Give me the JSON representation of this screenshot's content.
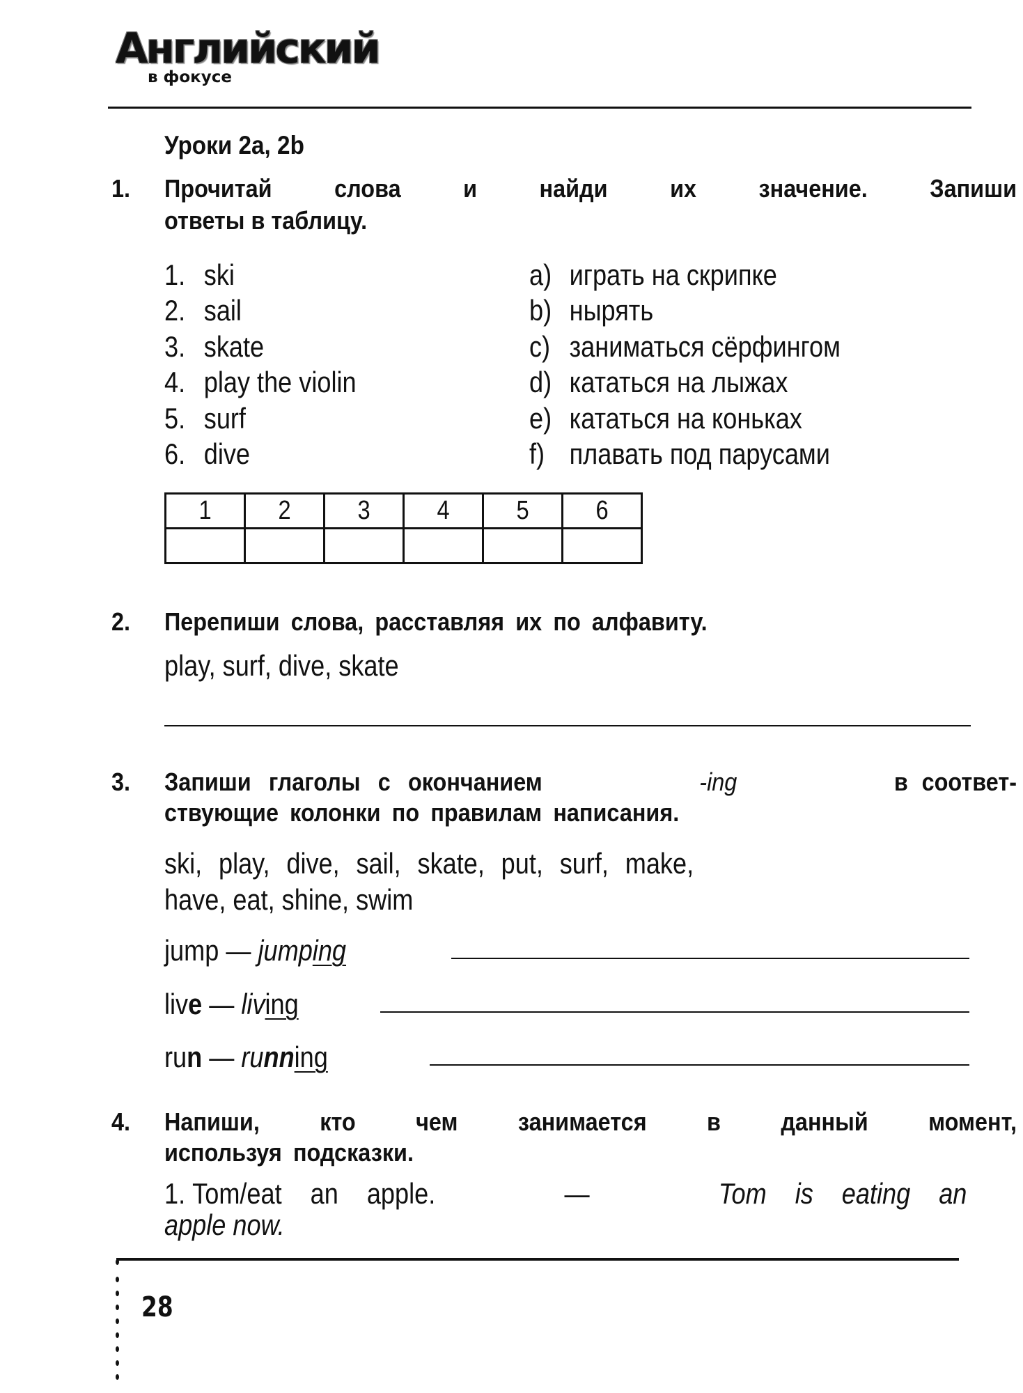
{
  "header": {
    "logo_title": "Английский",
    "logo_subtitle": "в фокусе"
  },
  "lesson_title": "Уроки 2a, 2b",
  "sections": [
    {
      "number": "1.",
      "instruction_lines": [
        "Прочитай слова и найди их значение. Запиши",
        "ответы в таблицу."
      ],
      "words": [
        {
          "num": "1.",
          "word": "ski"
        },
        {
          "num": "2.",
          "word": "sail"
        },
        {
          "num": "3.",
          "word": "skate"
        },
        {
          "num": "4.",
          "word": "play the violin"
        },
        {
          "num": "5.",
          "word": "surf"
        },
        {
          "num": "6.",
          "word": "dive"
        }
      ],
      "meanings": [
        {
          "letter": "a)",
          "text": "играть на скрипке"
        },
        {
          "letter": "b)",
          "text": "нырять"
        },
        {
          "letter": "c)",
          "text": "заниматься сёрфингом"
        },
        {
          "letter": "d)",
          "text": "кататься на лыжах"
        },
        {
          "letter": "e)",
          "text": "кататься на коньках"
        },
        {
          "letter": "f)",
          "text": "плавать под парусами"
        }
      ],
      "answer_table": {
        "headers": [
          "1",
          "2",
          "3",
          "4",
          "5",
          "6"
        ],
        "answers": [
          "",
          "",
          "",
          "",
          "",
          ""
        ]
      }
    },
    {
      "number": "2.",
      "instruction_lines": [
        "Перепиши слова, расставляя их по алфавиту."
      ],
      "words_line": "play, surf, dive, skate",
      "answer": ""
    },
    {
      "number": "3.",
      "instruction_lines": [
        "Запиши глаголы с окончанием",
        "-ing",
        "в соответ-",
        "ствующие колонки по правилам написания."
      ],
      "words_lines": [
        "ski, play, dive, sail, skate, put, surf, make,",
        "have, eat, shine, swim"
      ],
      "rules": [
        {
          "base": "jump",
          "base_bold": "",
          "dash": "—",
          "form_italic": "jump",
          "form_bold_italic": "",
          "form_italic2": "p",
          "suffix": "ing",
          "answer": ""
        },
        {
          "base": "liv",
          "base_bold": "e",
          "dash": "—",
          "form_italic": "liv",
          "form_bold_italic": "",
          "form_italic2": "",
          "suffix": "ing",
          "answer": ""
        },
        {
          "base": "ru",
          "base_bold": "n",
          "dash": "—",
          "form_italic": "ru",
          "form_bold_italic": "nn",
          "form_italic2": "",
          "suffix": "ing",
          "answer": ""
        }
      ]
    },
    {
      "number": "4.",
      "instruction_lines": [
        "Напиши, кто чем занимается в данный момент,",
        "используя подсказки."
      ],
      "example": {
        "num": "1.",
        "prompt": "Tom/eat an apple.",
        "dash": "—",
        "answer_line1": "Tom is eating an",
        "answer_line2": "apple now."
      }
    }
  ],
  "footer": {
    "page_number": "28"
  }
}
